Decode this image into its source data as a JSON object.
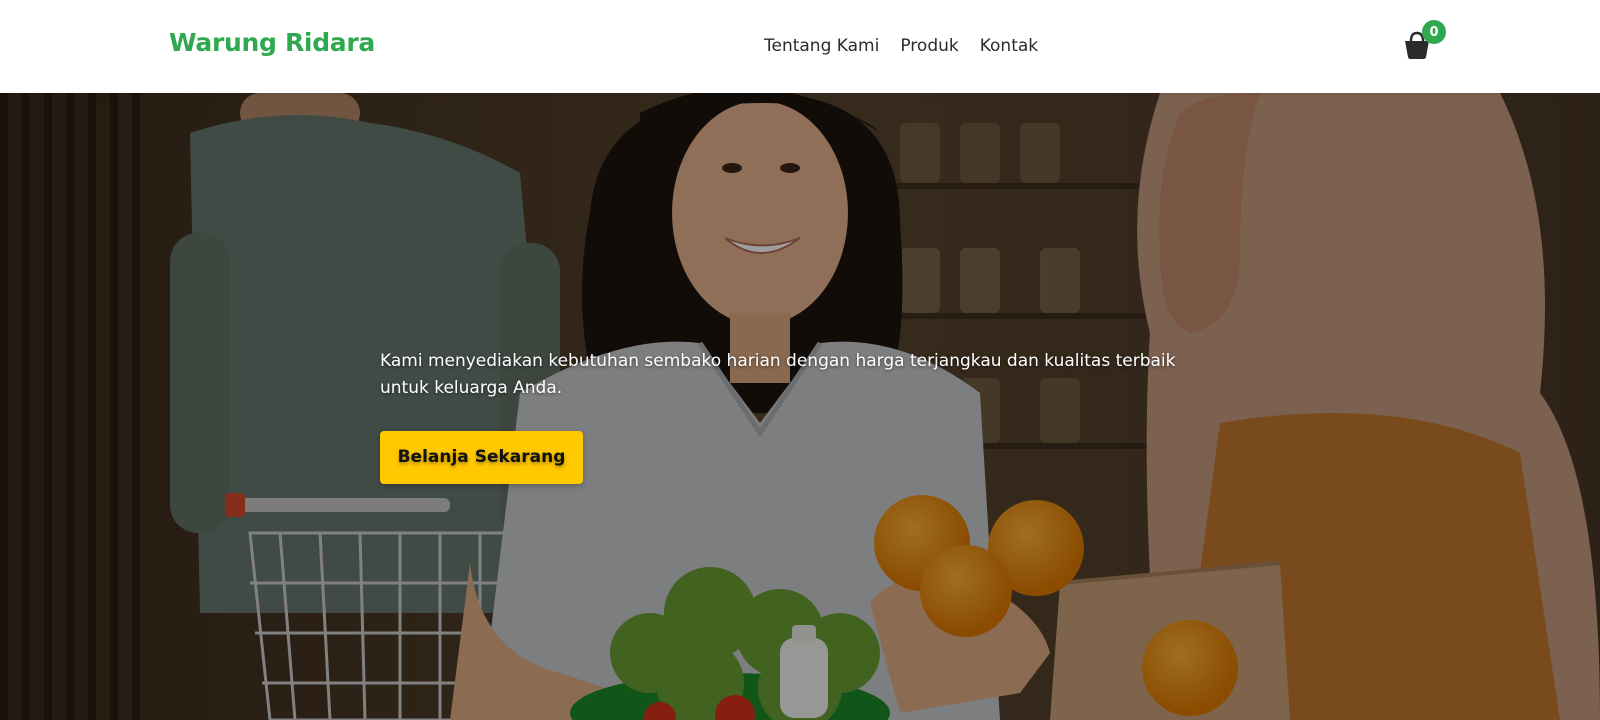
{
  "header": {
    "brand": "Warung Ridara",
    "nav": [
      {
        "label": "Tentang Kami"
      },
      {
        "label": "Produk"
      },
      {
        "label": "Kontak"
      }
    ],
    "cart_count": "0"
  },
  "hero": {
    "tagline": "Kami menyediakan kebutuhan sembako harian dengan harga terjangkau dan kualitas terbaik untuk keluarga Anda.",
    "cta_label": "Belanja Sekarang"
  },
  "colors": {
    "brand": "#2fa84f",
    "accent": "#ffc800"
  },
  "icons": {
    "cart": "shopping-basket-icon"
  }
}
